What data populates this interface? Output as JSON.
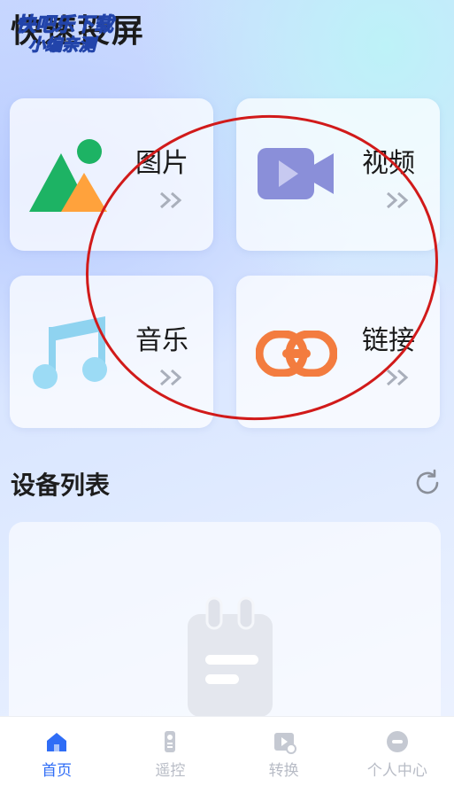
{
  "header": {
    "title": "快速投屏",
    "watermark_line1": "快吧乐下载",
    "watermark_line2": "小编亲测"
  },
  "media_cards": [
    {
      "label": "图片",
      "icon": "picture-icon"
    },
    {
      "label": "视频",
      "icon": "video-camera-icon"
    },
    {
      "label": "音乐",
      "icon": "music-note-icon"
    },
    {
      "label": "链接",
      "icon": "link-icon"
    }
  ],
  "devices": {
    "title": "设备列表",
    "refresh_icon": "refresh-icon",
    "empty_icon": "empty-notebook-icon"
  },
  "tabbar": {
    "items": [
      {
        "label": "首页",
        "icon": "home-icon",
        "active": true
      },
      {
        "label": "遥控",
        "icon": "remote-icon",
        "active": false
      },
      {
        "label": "转换",
        "icon": "convert-icon",
        "active": false
      },
      {
        "label": "个人中心",
        "icon": "profile-icon",
        "active": false
      }
    ]
  },
  "colors": {
    "accent": "#2f6df6",
    "annotation_circle": "#d11a1a",
    "tab_inactive": "#b8bcc6"
  }
}
